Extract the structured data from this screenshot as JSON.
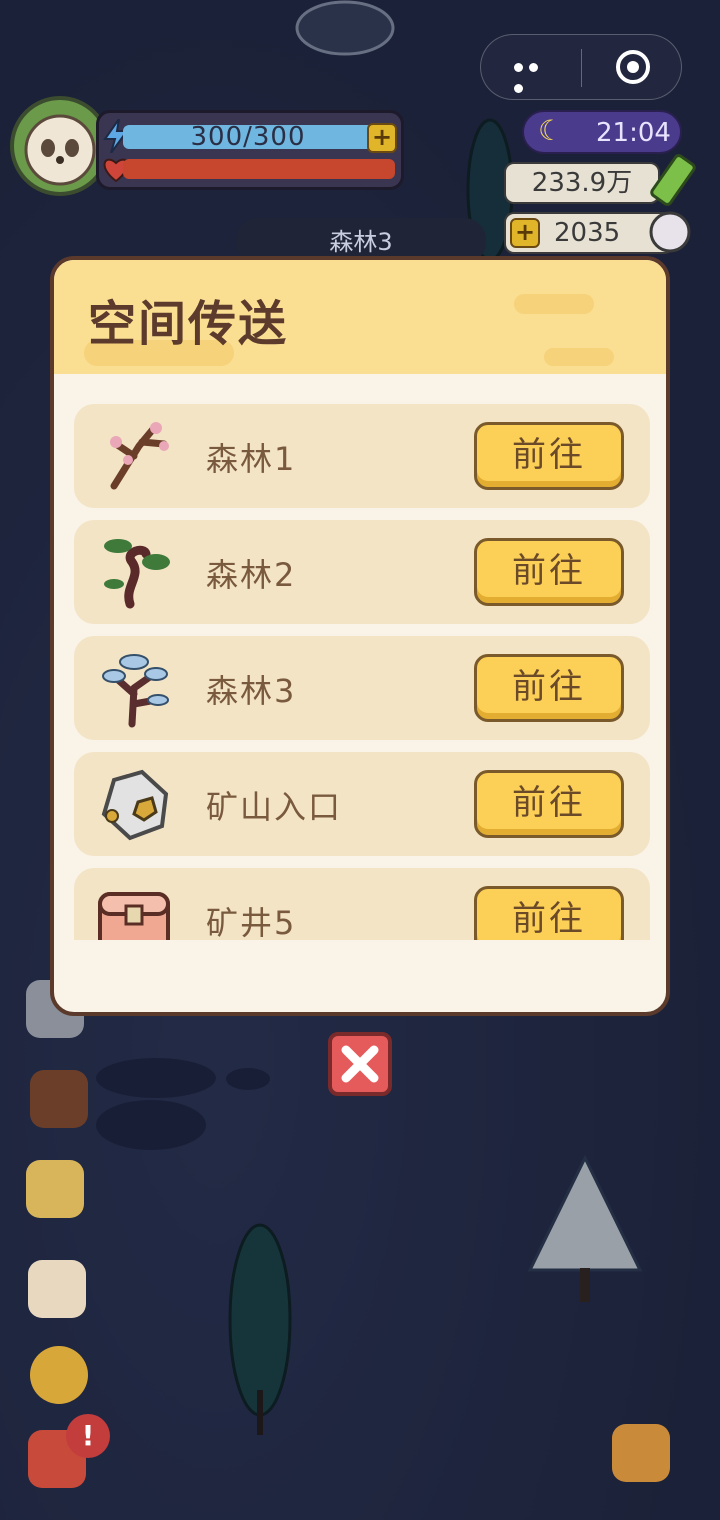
{
  "hud": {
    "energy_text": "300/300",
    "time": "21:04",
    "money": "233.9万",
    "pearls": "2035",
    "location": "森林3"
  },
  "dialog": {
    "title": "空间传送",
    "items": [
      {
        "name": "森林1",
        "button": "前往",
        "icon": "blossom-branch-icon"
      },
      {
        "name": "森林2",
        "button": "前往",
        "icon": "bonsai-tree-icon"
      },
      {
        "name": "森林3",
        "button": "前往",
        "icon": "mushroom-tree-icon"
      },
      {
        "name": "矿山入口",
        "button": "前往",
        "icon": "ore-rock-icon"
      },
      {
        "name": "矿井5",
        "button": "前往",
        "icon": "treasure-chest-icon"
      }
    ]
  },
  "badges": {
    "alert": "!"
  },
  "colors": {
    "dialog_bg": "#faf4e8",
    "header_bg": "#fadf92",
    "row_bg": "#f3e4c6",
    "button_bg": "#fcd056",
    "title_text": "#5c3a2c",
    "close_button": "#e55b5b"
  }
}
